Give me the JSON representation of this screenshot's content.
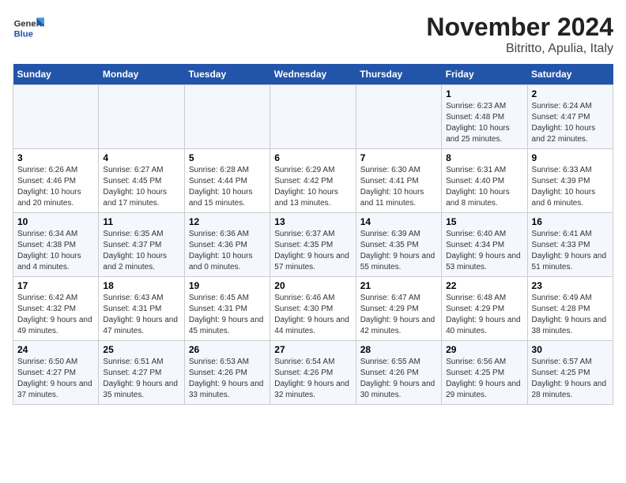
{
  "logo": {
    "text_general": "General",
    "text_blue": "Blue"
  },
  "title": "November 2024",
  "subtitle": "Bitritto, Apulia, Italy",
  "weekdays": [
    "Sunday",
    "Monday",
    "Tuesday",
    "Wednesday",
    "Thursday",
    "Friday",
    "Saturday"
  ],
  "weeks": [
    [
      {
        "day": "",
        "info": ""
      },
      {
        "day": "",
        "info": ""
      },
      {
        "day": "",
        "info": ""
      },
      {
        "day": "",
        "info": ""
      },
      {
        "day": "",
        "info": ""
      },
      {
        "day": "1",
        "info": "Sunrise: 6:23 AM\nSunset: 4:48 PM\nDaylight: 10 hours and 25 minutes."
      },
      {
        "day": "2",
        "info": "Sunrise: 6:24 AM\nSunset: 4:47 PM\nDaylight: 10 hours and 22 minutes."
      }
    ],
    [
      {
        "day": "3",
        "info": "Sunrise: 6:26 AM\nSunset: 4:46 PM\nDaylight: 10 hours and 20 minutes."
      },
      {
        "day": "4",
        "info": "Sunrise: 6:27 AM\nSunset: 4:45 PM\nDaylight: 10 hours and 17 minutes."
      },
      {
        "day": "5",
        "info": "Sunrise: 6:28 AM\nSunset: 4:44 PM\nDaylight: 10 hours and 15 minutes."
      },
      {
        "day": "6",
        "info": "Sunrise: 6:29 AM\nSunset: 4:42 PM\nDaylight: 10 hours and 13 minutes."
      },
      {
        "day": "7",
        "info": "Sunrise: 6:30 AM\nSunset: 4:41 PM\nDaylight: 10 hours and 11 minutes."
      },
      {
        "day": "8",
        "info": "Sunrise: 6:31 AM\nSunset: 4:40 PM\nDaylight: 10 hours and 8 minutes."
      },
      {
        "day": "9",
        "info": "Sunrise: 6:33 AM\nSunset: 4:39 PM\nDaylight: 10 hours and 6 minutes."
      }
    ],
    [
      {
        "day": "10",
        "info": "Sunrise: 6:34 AM\nSunset: 4:38 PM\nDaylight: 10 hours and 4 minutes."
      },
      {
        "day": "11",
        "info": "Sunrise: 6:35 AM\nSunset: 4:37 PM\nDaylight: 10 hours and 2 minutes."
      },
      {
        "day": "12",
        "info": "Sunrise: 6:36 AM\nSunset: 4:36 PM\nDaylight: 10 hours and 0 minutes."
      },
      {
        "day": "13",
        "info": "Sunrise: 6:37 AM\nSunset: 4:35 PM\nDaylight: 9 hours and 57 minutes."
      },
      {
        "day": "14",
        "info": "Sunrise: 6:39 AM\nSunset: 4:35 PM\nDaylight: 9 hours and 55 minutes."
      },
      {
        "day": "15",
        "info": "Sunrise: 6:40 AM\nSunset: 4:34 PM\nDaylight: 9 hours and 53 minutes."
      },
      {
        "day": "16",
        "info": "Sunrise: 6:41 AM\nSunset: 4:33 PM\nDaylight: 9 hours and 51 minutes."
      }
    ],
    [
      {
        "day": "17",
        "info": "Sunrise: 6:42 AM\nSunset: 4:32 PM\nDaylight: 9 hours and 49 minutes."
      },
      {
        "day": "18",
        "info": "Sunrise: 6:43 AM\nSunset: 4:31 PM\nDaylight: 9 hours and 47 minutes."
      },
      {
        "day": "19",
        "info": "Sunrise: 6:45 AM\nSunset: 4:31 PM\nDaylight: 9 hours and 45 minutes."
      },
      {
        "day": "20",
        "info": "Sunrise: 6:46 AM\nSunset: 4:30 PM\nDaylight: 9 hours and 44 minutes."
      },
      {
        "day": "21",
        "info": "Sunrise: 6:47 AM\nSunset: 4:29 PM\nDaylight: 9 hours and 42 minutes."
      },
      {
        "day": "22",
        "info": "Sunrise: 6:48 AM\nSunset: 4:29 PM\nDaylight: 9 hours and 40 minutes."
      },
      {
        "day": "23",
        "info": "Sunrise: 6:49 AM\nSunset: 4:28 PM\nDaylight: 9 hours and 38 minutes."
      }
    ],
    [
      {
        "day": "24",
        "info": "Sunrise: 6:50 AM\nSunset: 4:27 PM\nDaylight: 9 hours and 37 minutes."
      },
      {
        "day": "25",
        "info": "Sunrise: 6:51 AM\nSunset: 4:27 PM\nDaylight: 9 hours and 35 minutes."
      },
      {
        "day": "26",
        "info": "Sunrise: 6:53 AM\nSunset: 4:26 PM\nDaylight: 9 hours and 33 minutes."
      },
      {
        "day": "27",
        "info": "Sunrise: 6:54 AM\nSunset: 4:26 PM\nDaylight: 9 hours and 32 minutes."
      },
      {
        "day": "28",
        "info": "Sunrise: 6:55 AM\nSunset: 4:26 PM\nDaylight: 9 hours and 30 minutes."
      },
      {
        "day": "29",
        "info": "Sunrise: 6:56 AM\nSunset: 4:25 PM\nDaylight: 9 hours and 29 minutes."
      },
      {
        "day": "30",
        "info": "Sunrise: 6:57 AM\nSunset: 4:25 PM\nDaylight: 9 hours and 28 minutes."
      }
    ]
  ]
}
